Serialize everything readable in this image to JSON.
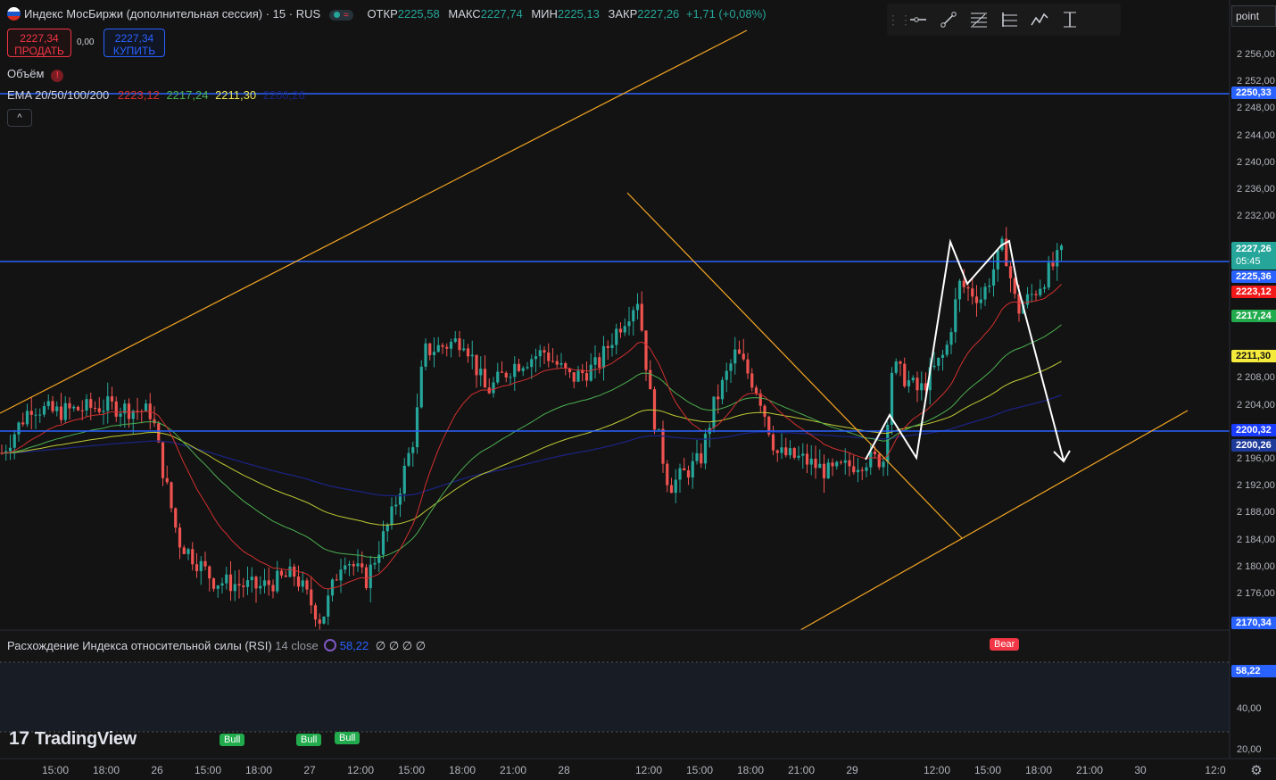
{
  "header": {
    "symbol_title": "Индекс МосБиржи (дополнительная сессия) · 15 · RUS",
    "open_label": "ОТКР",
    "open_value": "2225,58",
    "high_label": "МАКС",
    "high_value": "2227,74",
    "low_label": "МИН",
    "low_value": "2225,13",
    "close_label": "ЗАКР",
    "close_value": "2227,26",
    "change": "+1,71 (+0,08%)"
  },
  "trade": {
    "sell_price": "2227,34",
    "sell_label": "ПРОДАТЬ",
    "spread": "0,00",
    "buy_price": "2227,34",
    "buy_label": "КУПИТЬ"
  },
  "indicators": {
    "volume_label": "Объём",
    "ema_label": "EMA 20/50/100/200",
    "ema20": "2223,12",
    "ema50": "2217,24",
    "ema100": "2211,30",
    "ema200": "2200,26",
    "collapse_icon": "^"
  },
  "rsi": {
    "title": "Расхождение Индекса относительной силы (RSI)",
    "params": "14 close",
    "value": "58,22",
    "extras": "∅ ∅ ∅ ∅",
    "signals": {
      "bull": "Bull",
      "bear": "Bear"
    }
  },
  "toolbar": {
    "tools": [
      "horizontal-ray-icon",
      "trend-line-icon",
      "fib-retracement-icon",
      "pitchfork-icon",
      "path-icon",
      "date-range-icon"
    ]
  },
  "axis": {
    "mode": "point",
    "price_ticks": [
      "2 256,00",
      "2 252,00",
      "2 248,00",
      "2 244,00",
      "2 240,00",
      "2 236,00",
      "2 232,00",
      "2 208,00",
      "2 204,00",
      "2 196,00",
      "2 192,00",
      "2 188,00",
      "2 184,00",
      "2 180,00",
      "2 176,00"
    ],
    "rsi_ticks": [
      "40,00",
      "20,00"
    ],
    "time_ticks": [
      "15:00",
      "18:00",
      "26",
      "15:00",
      "18:00",
      "27",
      "12:00",
      "15:00",
      "18:00",
      "21:00",
      "28",
      "12:00",
      "15:00",
      "18:00",
      "21:00",
      "29",
      "12:00",
      "15:00",
      "18:00",
      "21:00",
      "30",
      "12:0"
    ]
  },
  "price_tags": {
    "level_top": "2250,33",
    "last_price": "2227,26",
    "countdown": "05:45",
    "level_mid": "2225,36",
    "ema20": "2223,12",
    "ema50": "2217,24",
    "ema100": "2211,30",
    "level_low": "2200,32",
    "ema200": "2200,26",
    "bottom": "2170,34",
    "rsi": "58,22"
  },
  "colors": {
    "background": "#131313",
    "up": "#26a69a",
    "down": "#ef5350",
    "ema20": "#d32f2f",
    "ema50": "#4caf50",
    "ema100": "#c0ca33",
    "ema200": "#1a237e",
    "level": "#2962ff",
    "trend": "#f5a623",
    "rsi": "#2962ff"
  },
  "branding": {
    "logo_text": "TradingView"
  }
}
